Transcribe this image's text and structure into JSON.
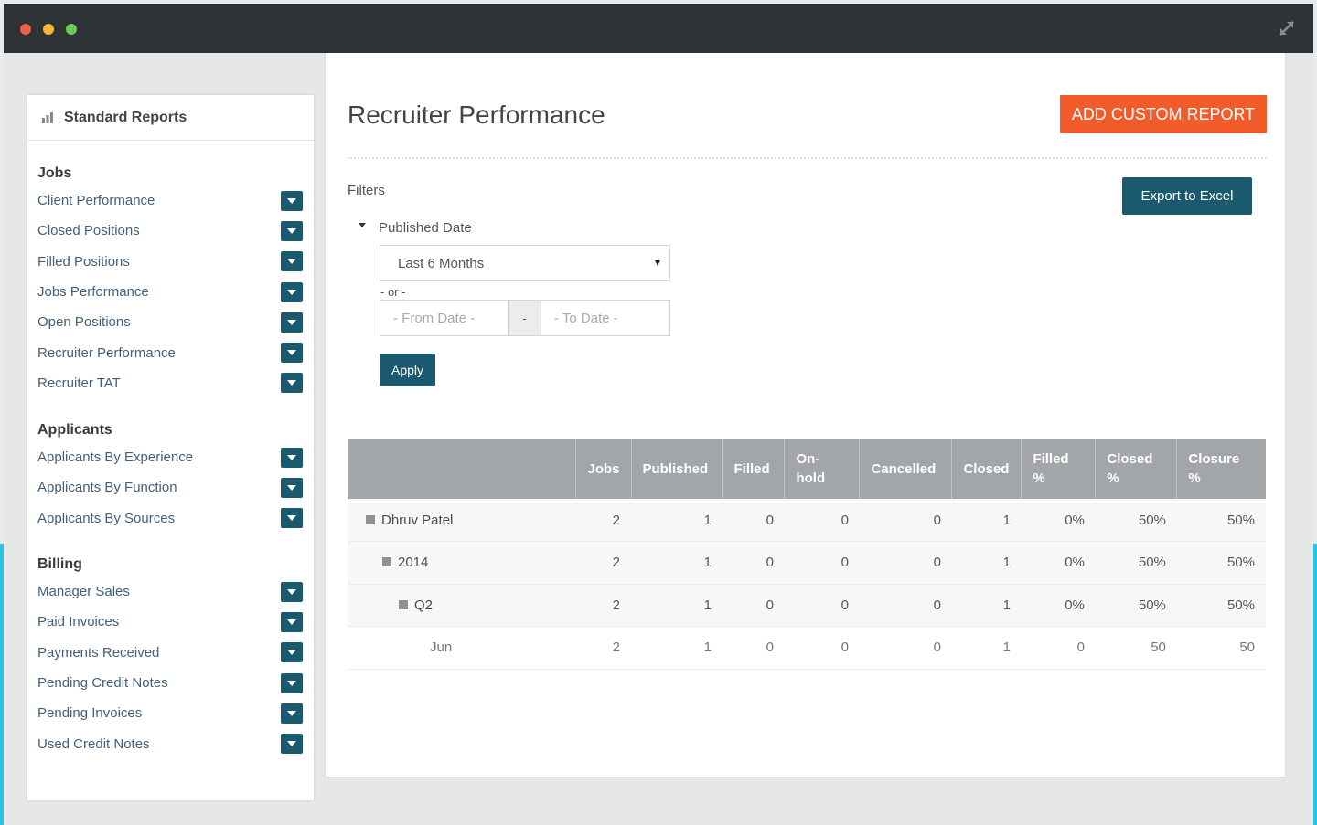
{
  "sidebar": {
    "title": "Standard Reports",
    "groups": [
      {
        "title": "Jobs",
        "items": [
          "Client Performance",
          "Closed Positions",
          "Filled Positions",
          "Jobs Performance",
          "Open Positions",
          "Recruiter Performance",
          "Recruiter TAT"
        ]
      },
      {
        "title": "Applicants",
        "items": [
          "Applicants By Experience",
          "Applicants By Function",
          "Applicants By Sources"
        ]
      },
      {
        "title": "Billing",
        "items": [
          "Manager Sales",
          "Paid Invoices",
          "Payments Received",
          "Pending Credit Notes",
          "Pending Invoices",
          "Used Credit Notes"
        ]
      }
    ]
  },
  "main": {
    "title": "Recruiter Performance",
    "add_button": "ADD CUSTOM REPORT",
    "filters_label": "Filters",
    "export_button": "Export to Excel",
    "published_date_label": "Published Date",
    "period_select": "Last 6 Months",
    "or_text": "- or -",
    "from_date_placeholder": "- From Date -",
    "date_separator": "-",
    "to_date_placeholder": "- To Date -",
    "apply_button": "Apply"
  },
  "table": {
    "columns": [
      "",
      "Jobs",
      "Published",
      "Filled",
      "On-hold",
      "Cancelled",
      "Closed",
      "Filled %",
      "Closed %",
      "Closure %"
    ],
    "rows": [
      {
        "name": "Dhruv Patel",
        "values": [
          "2",
          "1",
          "0",
          "0",
          "0",
          "1",
          "0%",
          "50%",
          "50%"
        ]
      },
      {
        "name": "2014",
        "values": [
          "2",
          "1",
          "0",
          "0",
          "0",
          "1",
          "0%",
          "50%",
          "50%"
        ]
      },
      {
        "name": "Q2",
        "values": [
          "2",
          "1",
          "0",
          "0",
          "0",
          "1",
          "0%",
          "50%",
          "50%"
        ]
      },
      {
        "name": "Jun",
        "values": [
          "2",
          "1",
          "0",
          "0",
          "0",
          "1",
          "0",
          "50",
          "50"
        ]
      }
    ]
  },
  "colors": {
    "primary": "#1b5a6e",
    "accent": "#f25c2b",
    "header_gray": "#a3a6a8",
    "titlebar": "#2e3336"
  }
}
